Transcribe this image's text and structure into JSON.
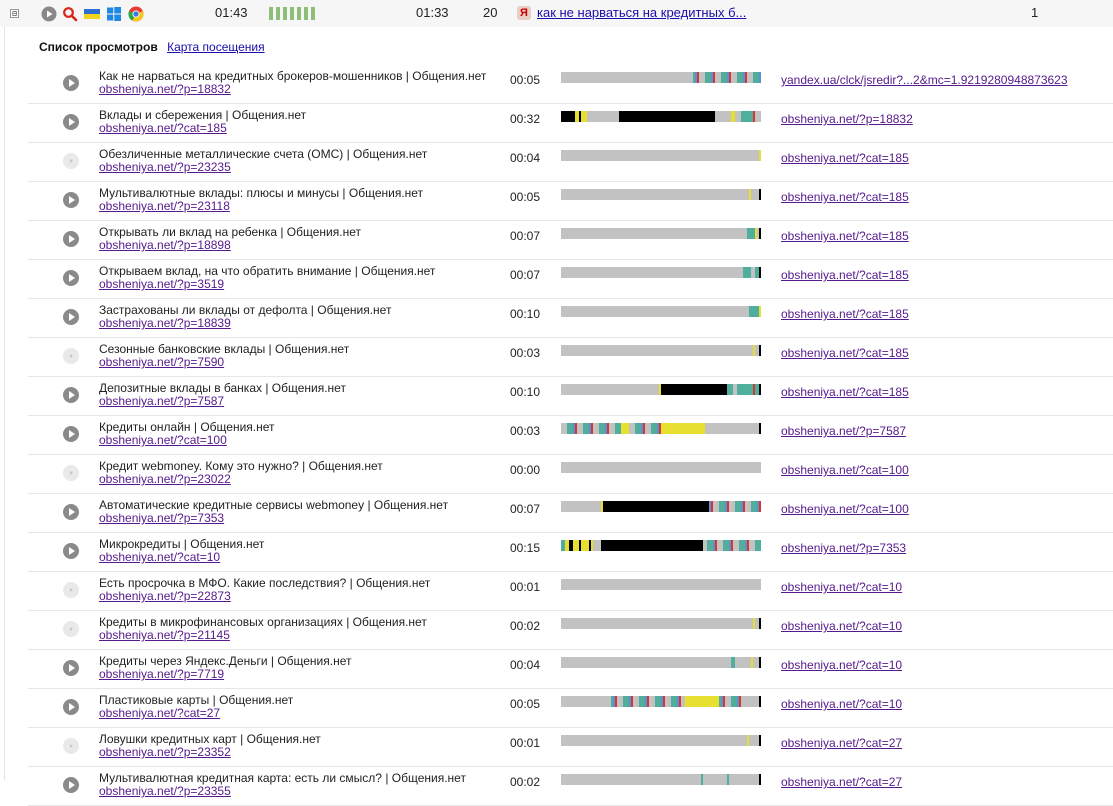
{
  "session": {
    "expander": "⊟",
    "duration": "01:43",
    "time": "01:33",
    "pages": "20",
    "search_badge": "Я",
    "search_query": "как не нарваться на кредитных б...",
    "count": "1",
    "icons": [
      "play-icon",
      "search-icon",
      "ukraine-flag-icon",
      "windows-icon",
      "chrome-icon"
    ],
    "activity_bars": 7
  },
  "panel": {
    "title": "Список просмотров",
    "map_link": "Карта посещения"
  },
  "colors": {
    "idle": "#c2c2c2",
    "active": "#000000",
    "teal": "#4fae9c",
    "yellow": "#e8e030",
    "red": "#d9362d",
    "blue": "#5c8fd6"
  },
  "rows": [
    {
      "title": "Как не нарваться на кредитных брокеров-мошенников | Общения.нет",
      "url": "obsheniya.net/?p=18832",
      "time": "00:05",
      "referrer": "yandex.ua/clck/jsredir?...2&mc=1.9219280948873623",
      "playable": true,
      "segments": [
        [
          "idle",
          0.66
        ],
        [
          "stripe",
          0.34
        ]
      ]
    },
    {
      "title": "Вклады и сбережения | Общения.нет",
      "url": "obsheniya.net/?cat=185",
      "time": "00:32",
      "referrer": "obsheniya.net/?p=18832",
      "playable": true,
      "segments": [
        [
          "active",
          0.07
        ],
        [
          "yellow",
          0.02
        ],
        [
          "active",
          0.01
        ],
        [
          "yellow",
          0.03
        ],
        [
          "idle",
          0.16
        ],
        [
          "active",
          0.48
        ],
        [
          "idle",
          0.08
        ],
        [
          "yellow",
          0.02
        ],
        [
          "idle",
          0.03
        ],
        [
          "teal",
          0.06
        ],
        [
          "red",
          0.01
        ],
        [
          "idle",
          0.03
        ]
      ]
    },
    {
      "title": "Обезличенные металлические счета (ОМС) | Общения.нет",
      "url": "obsheniya.net/?p=23235",
      "time": "00:04",
      "referrer": "obsheniya.net/?cat=185",
      "playable": false,
      "segments": [
        [
          "idle",
          0.99
        ],
        [
          "yellow",
          0.01
        ]
      ]
    },
    {
      "title": "Мультивалютные вклады: плюсы и минусы | Общения.нет",
      "url": "obsheniya.net/?p=23118",
      "time": "00:05",
      "referrer": "obsheniya.net/?cat=185",
      "playable": true,
      "segments": [
        [
          "idle",
          0.94
        ],
        [
          "yellow",
          0.01
        ],
        [
          "idle",
          0.04
        ],
        [
          "active",
          0.01
        ]
      ]
    },
    {
      "title": "Открывать ли вклад на ребенка | Общения.нет",
      "url": "obsheniya.net/?p=18898",
      "time": "00:07",
      "referrer": "obsheniya.net/?cat=185",
      "playable": true,
      "segments": [
        [
          "idle",
          0.93
        ],
        [
          "teal",
          0.04
        ],
        [
          "yellow",
          0.01
        ],
        [
          "idle",
          0.01
        ],
        [
          "active",
          0.01
        ]
      ]
    },
    {
      "title": "Открываем вклад, на что обратить внимание | Общения.нет",
      "url": "obsheniya.net/?p=3519",
      "time": "00:07",
      "referrer": "obsheniya.net/?cat=185",
      "playable": true,
      "segments": [
        [
          "idle",
          0.91
        ],
        [
          "teal",
          0.04
        ],
        [
          "idle",
          0.02
        ],
        [
          "teal",
          0.02
        ],
        [
          "active",
          0.01
        ]
      ]
    },
    {
      "title": "Застрахованы ли вклады от дефолта | Общения.нет",
      "url": "obsheniya.net/?p=18839",
      "time": "00:10",
      "referrer": "obsheniya.net/?cat=185",
      "playable": true,
      "segments": [
        [
          "idle",
          0.94
        ],
        [
          "teal",
          0.05
        ],
        [
          "yellow",
          0.01
        ]
      ]
    },
    {
      "title": "Сезонные банковские вклады | Общения.нет",
      "url": "obsheniya.net/?p=7590",
      "time": "00:03",
      "referrer": "obsheniya.net/?cat=185",
      "playable": false,
      "segments": [
        [
          "idle",
          0.96
        ],
        [
          "yellow",
          0.01
        ],
        [
          "idle",
          0.02
        ],
        [
          "active",
          0.01
        ]
      ]
    },
    {
      "title": "Депозитные вклады в банках | Общения.нет",
      "url": "obsheniya.net/?p=7587",
      "time": "00:10",
      "referrer": "obsheniya.net/?cat=185",
      "playable": true,
      "segments": [
        [
          "idle",
          0.49
        ],
        [
          "yellow",
          0.01
        ],
        [
          "active",
          0.33
        ],
        [
          "teal",
          0.03
        ],
        [
          "idle",
          0.02
        ],
        [
          "teal",
          0.08
        ],
        [
          "red",
          0.01
        ],
        [
          "teal",
          0.02
        ],
        [
          "active",
          0.01
        ]
      ]
    },
    {
      "title": "Кредиты онлайн | Общения.нет",
      "url": "obsheniya.net/?cat=100",
      "time": "00:03",
      "referrer": "obsheniya.net/?p=7587",
      "playable": true,
      "segments": [
        [
          "stripe",
          0.3
        ],
        [
          "yellow",
          0.04
        ],
        [
          "stripe",
          0.16
        ],
        [
          "yellow",
          0.22
        ],
        [
          "idle",
          0.27
        ],
        [
          "active",
          0.01
        ]
      ]
    },
    {
      "title": "Кредит webmoney. Кому это нужно? | Общения.нет",
      "url": "obsheniya.net/?p=23022",
      "time": "00:00",
      "referrer": "obsheniya.net/?cat=100",
      "playable": false,
      "segments": [
        [
          "idle",
          1.0
        ]
      ]
    },
    {
      "title": "Автоматические кредитные сервисы webmoney | Общения.нет",
      "url": "obsheniya.net/?p=7353",
      "time": "00:07",
      "referrer": "obsheniya.net/?cat=100",
      "playable": true,
      "segments": [
        [
          "idle",
          0.2
        ],
        [
          "yellow",
          0.01
        ],
        [
          "active",
          0.53
        ],
        [
          "stripe",
          0.26
        ]
      ]
    },
    {
      "title": "Микрокредиты | Общения.нет",
      "url": "obsheniya.net/?cat=10",
      "time": "00:15",
      "referrer": "obsheniya.net/?p=7353",
      "playable": true,
      "segments": [
        [
          "teal",
          0.02
        ],
        [
          "yellow",
          0.02
        ],
        [
          "active",
          0.02
        ],
        [
          "yellow",
          0.03
        ],
        [
          "active",
          0.01
        ],
        [
          "yellow",
          0.04
        ],
        [
          "active",
          0.01
        ],
        [
          "yellow",
          0.01
        ],
        [
          "idle",
          0.04
        ],
        [
          "active",
          0.51
        ],
        [
          "stripe",
          0.29
        ]
      ]
    },
    {
      "title": "Есть просрочка в МФО. Какие последствия? | Общения.нет",
      "url": "obsheniya.net/?p=22873",
      "time": "00:01",
      "referrer": "obsheniya.net/?cat=10",
      "playable": false,
      "segments": [
        [
          "idle",
          1.0
        ]
      ]
    },
    {
      "title": "Кредиты в микрофинансовых организациях | Общения.нет",
      "url": "obsheniya.net/?p=21145",
      "time": "00:02",
      "referrer": "obsheniya.net/?cat=10",
      "playable": false,
      "segments": [
        [
          "idle",
          0.96
        ],
        [
          "yellow",
          0.01
        ],
        [
          "idle",
          0.02
        ],
        [
          "active",
          0.01
        ]
      ]
    },
    {
      "title": "Кредиты через Яндекс.Деньги | Общения.нет",
      "url": "obsheniya.net/?p=7719",
      "time": "00:04",
      "referrer": "obsheniya.net/?cat=10",
      "playable": true,
      "segments": [
        [
          "idle",
          0.85
        ],
        [
          "teal",
          0.02
        ],
        [
          "idle",
          0.08
        ],
        [
          "yellow",
          0.01
        ],
        [
          "idle",
          0.03
        ],
        [
          "active",
          0.01
        ]
      ]
    },
    {
      "title": "Пластиковые карты | Общения.нет",
      "url": "obsheniya.net/?cat=27",
      "time": "00:05",
      "referrer": "obsheniya.net/?cat=10",
      "playable": true,
      "segments": [
        [
          "idle",
          0.25
        ],
        [
          "stripe",
          0.37
        ],
        [
          "yellow",
          0.17
        ],
        [
          "stripe",
          0.12
        ],
        [
          "idle",
          0.08
        ],
        [
          "active",
          0.01
        ]
      ]
    },
    {
      "title": "Ловушки кредитных карт | Общения.нет",
      "url": "obsheniya.net/?p=23352",
      "time": "00:01",
      "referrer": "obsheniya.net/?cat=27",
      "playable": false,
      "segments": [
        [
          "idle",
          0.93
        ],
        [
          "yellow",
          0.01
        ],
        [
          "idle",
          0.05
        ],
        [
          "active",
          0.01
        ]
      ]
    },
    {
      "title": "Мультивалютная кредитная карта: есть ли смысл? | Общения.нет",
      "url": "obsheniya.net/?p=23355",
      "time": "00:02",
      "referrer": "obsheniya.net/?cat=27",
      "playable": true,
      "segments": [
        [
          "idle",
          0.7
        ],
        [
          "teal",
          0.01
        ],
        [
          "idle",
          0.12
        ],
        [
          "teal",
          0.01
        ],
        [
          "idle",
          0.15
        ],
        [
          "active",
          0.01
        ]
      ]
    }
  ]
}
